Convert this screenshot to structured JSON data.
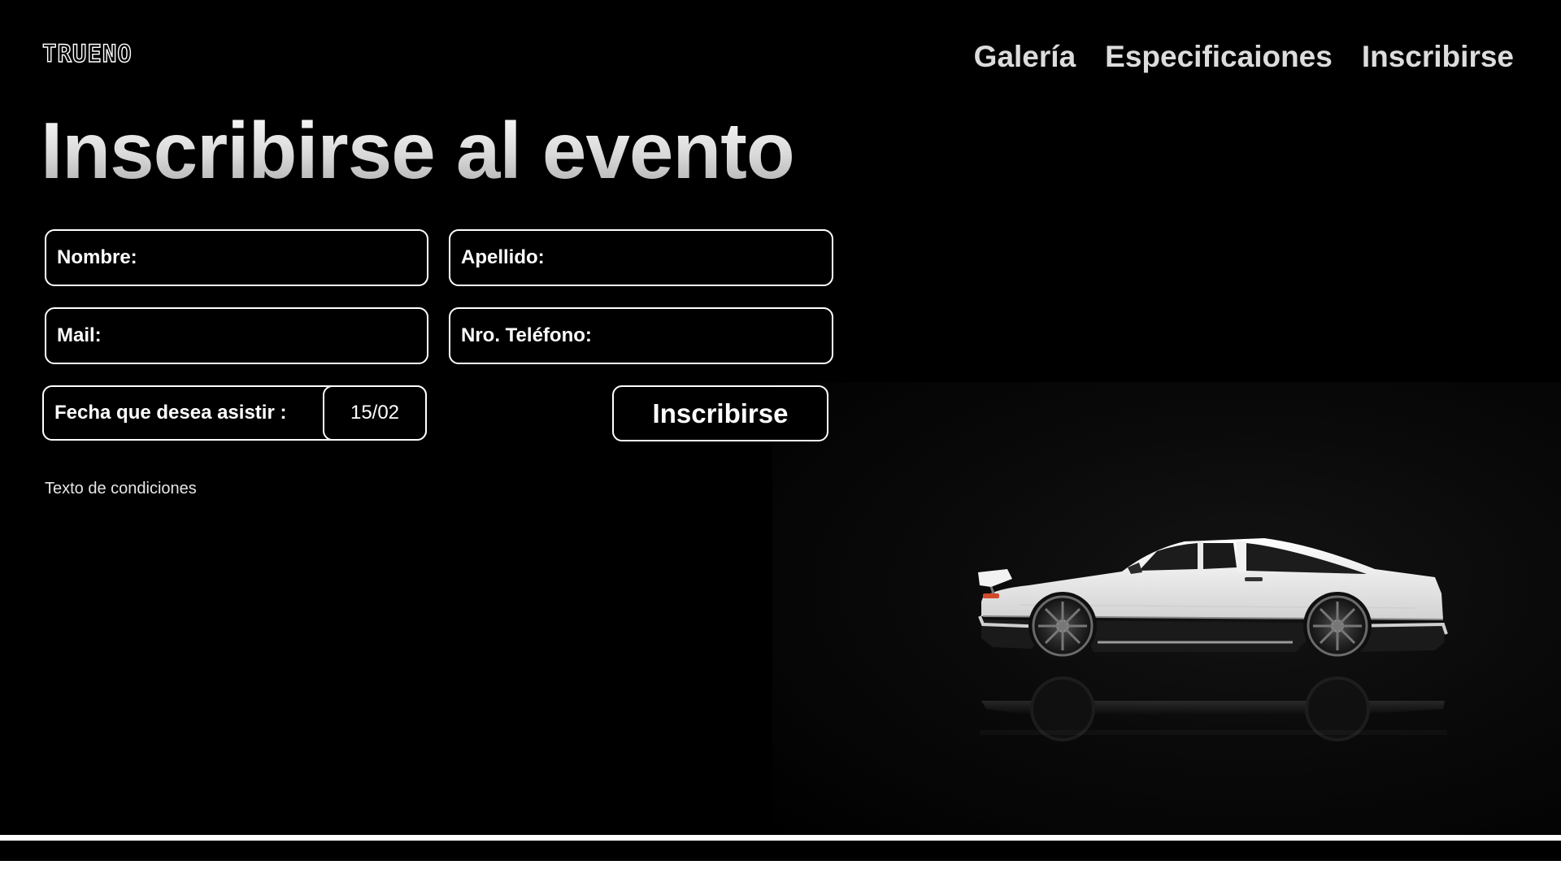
{
  "brand": {
    "logo_text": "TRUENO"
  },
  "nav": {
    "items": [
      {
        "label": "Galería"
      },
      {
        "label": "Especificaiones"
      },
      {
        "label": "Inscribirse"
      }
    ]
  },
  "page": {
    "title": "Inscribirse al evento"
  },
  "form": {
    "nombre_label": "Nombre:",
    "apellido_label": "Apellido:",
    "mail_label": "Mail:",
    "telefono_label": "Nro. Teléfono:",
    "fecha_label": "Fecha que desea asistir :",
    "fecha_value": "15/02",
    "submit_label": "Inscribirse",
    "terms_text": "Texto de condiciones"
  },
  "hero_image": {
    "subject": "car-image"
  },
  "colors": {
    "background": "#000000",
    "text": "#ffffff",
    "nav_text": "#dcdcdc",
    "border": "#ffffff"
  }
}
